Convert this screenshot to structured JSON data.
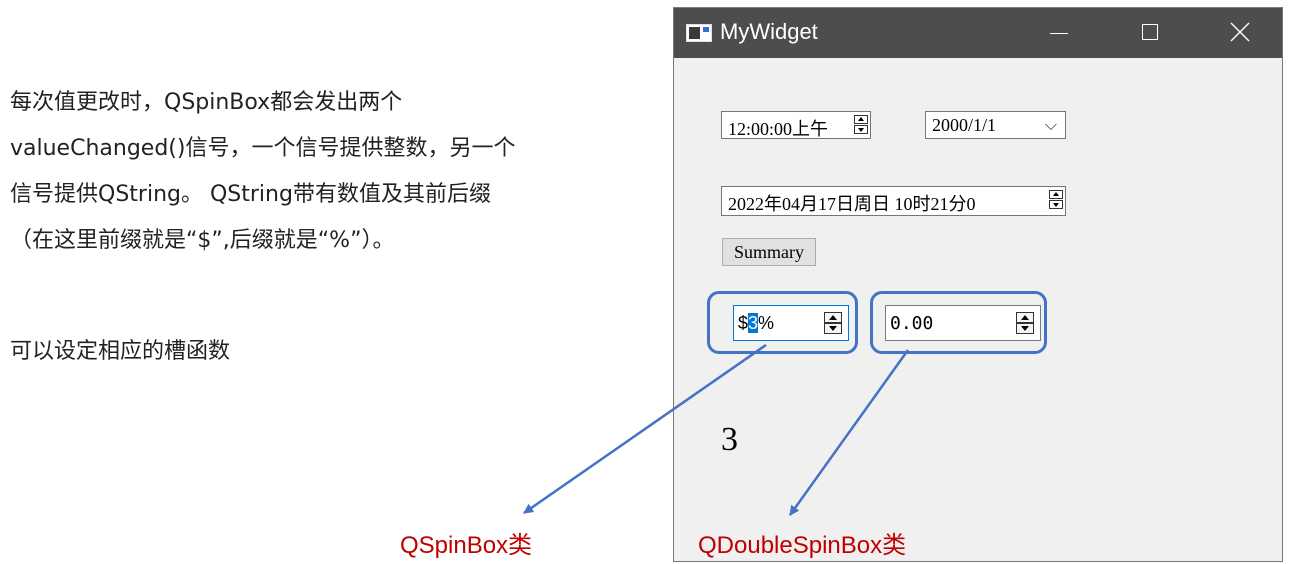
{
  "description": {
    "lines": [
      "每次值更改时，QSpinBox都会发出两个",
      "valueChanged()信号，一个信号提供整数，另一个",
      "信号提供QString。 QString带有数值及其前后缀",
      "（在这里前缀就是“$”,后缀就是“%”）。"
    ],
    "note": "可以设定相应的槽函数"
  },
  "window": {
    "title": "MyWidget",
    "time_edit": "12:00:00上午",
    "date_combo": "2000/1/1",
    "datetime_edit": "2022年04月17日周日 10时21分0",
    "summary_button": "Summary",
    "int_spin": {
      "prefix": "$",
      "value": "3",
      "suffix": "%"
    },
    "double_spin": "0.00",
    "value_label": "3"
  },
  "captions": {
    "int": "QSpinBox类",
    "double": "QDoubleSpinBox类"
  },
  "colors": {
    "highlight": "#4472c4",
    "caption": "#c00000",
    "titlebar": "#4d4d4d"
  }
}
